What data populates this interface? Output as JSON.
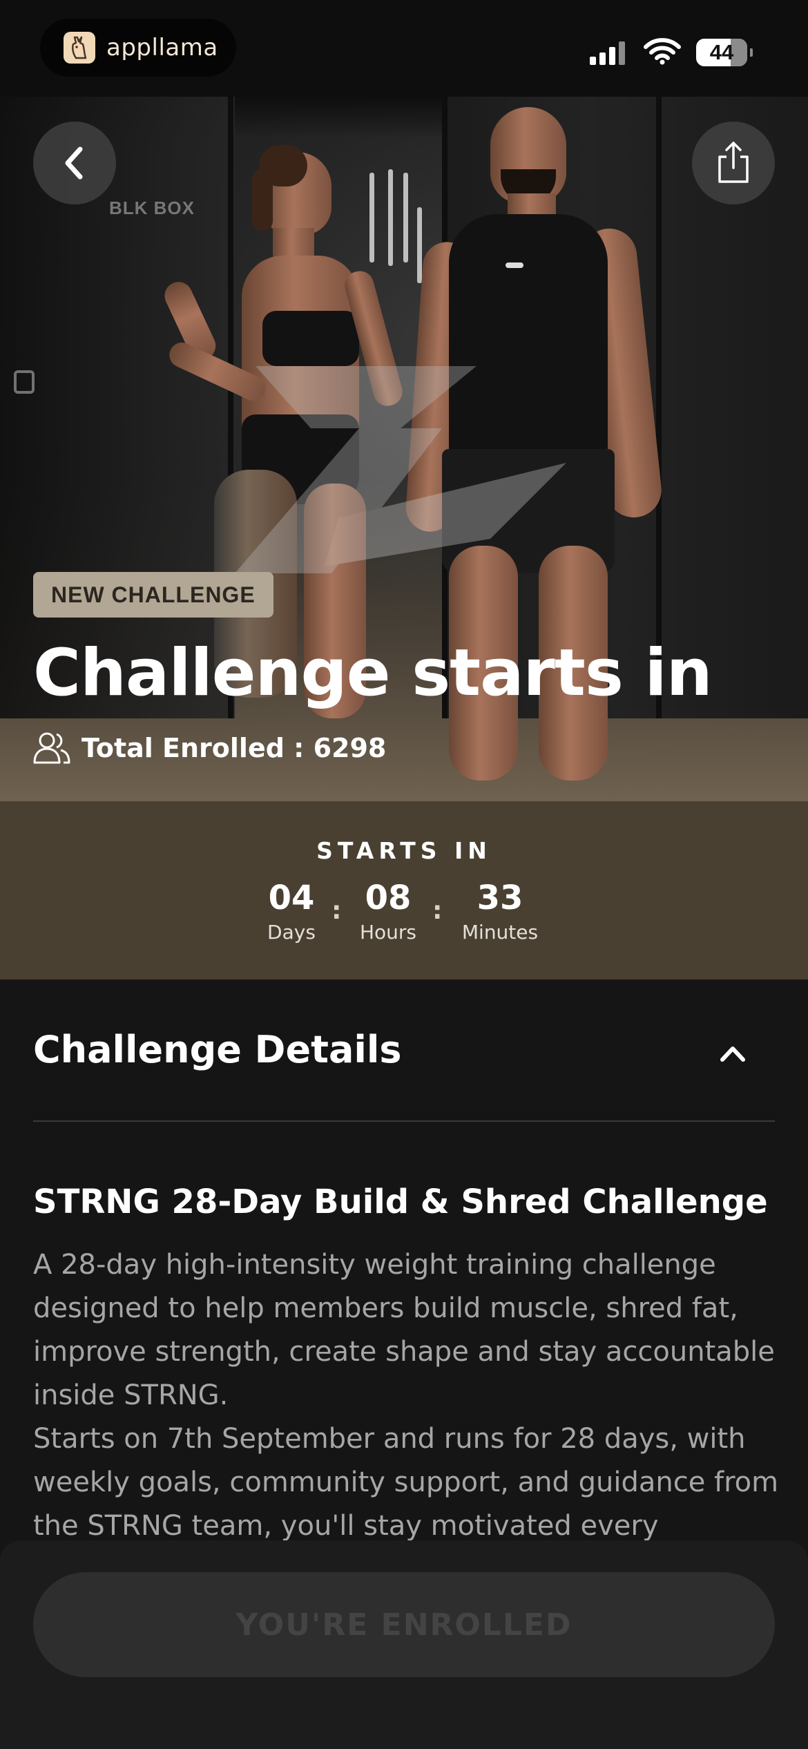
{
  "status_bar": {
    "brand_name": "appllama",
    "battery": "44"
  },
  "hero": {
    "badge": "NEW CHALLENGE",
    "title": "Challenge starts in",
    "enrolled_text": "Total Enrolled : 6298",
    "gym_sign": "BLK BOX"
  },
  "countdown": {
    "title": "STARTS IN",
    "days": "04",
    "days_label": "Days",
    "hours": "08",
    "hours_label": "Hours",
    "minutes": "33",
    "minutes_label": "Minutes",
    "separator": ":"
  },
  "details": {
    "heading": "Challenge Details",
    "name": "STRNG 28-Day Build & Shred Challenge",
    "description_1": "A 28-day high-intensity weight training challenge designed to help members build muscle, shred fat, improve strength, create shape and stay accountable inside STRNG.",
    "description_2": "Starts on 7th September and runs for 28 days, with weekly goals, community support, and guidance from the STRNG team, you'll stay motivated every"
  },
  "footer": {
    "enroll_button": "YOU'RE ENROLLED"
  },
  "icons": {
    "back": "chevron-left-icon",
    "share": "share-icon",
    "users": "users-icon",
    "collapse": "chevron-up-icon"
  },
  "colors": {
    "countdown_bg": "#4a4032",
    "badge_bg": "#b2a694",
    "page_bg": "#151515"
  }
}
